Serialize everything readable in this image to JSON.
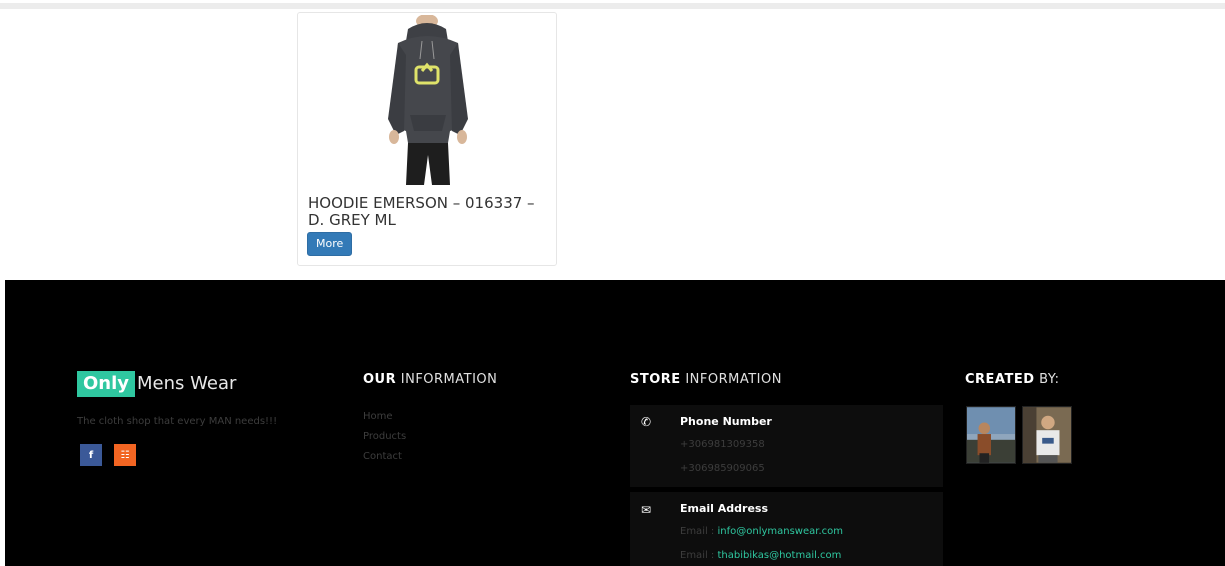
{
  "product": {
    "title": "HOODIE EMERSON – 016337 – D. GREY ML",
    "button_label": "More"
  },
  "footer": {
    "brand_highlight": "Only",
    "brand_rest": "Mens Wear",
    "tagline": "The cloth shop that every MAN needs!!!",
    "social": [
      "f",
      "☷"
    ],
    "our_info": {
      "heading_bold": "OUR",
      "heading_rest": " INFORMATION",
      "links": [
        "Home",
        "Products",
        "Contact"
      ]
    },
    "store_info": {
      "heading_bold": "STORE",
      "heading_rest": " INFORMATION",
      "phone_title": "Phone Number",
      "phones": [
        "+306981309358",
        "+306985909065"
      ],
      "email_title": "Email Address",
      "email_label": "Email :",
      "emails": [
        "info@onlymanswear.com",
        "thabibikas@hotmail.com"
      ]
    },
    "created_by": {
      "heading_bold": "CREATED",
      "heading_rest": " BY:"
    }
  },
  "colors": {
    "accent": "#2fc7a0",
    "button_blue": "#337ab7",
    "facebook": "#3b5998",
    "rss": "#f26522",
    "footer_bg": "#000000"
  }
}
